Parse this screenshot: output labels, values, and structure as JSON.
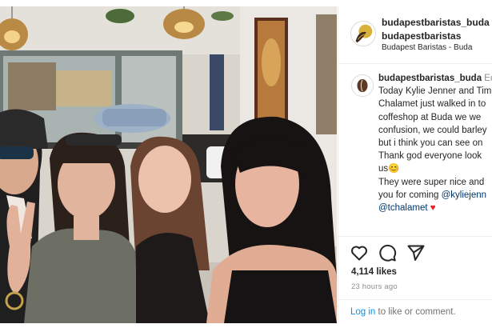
{
  "post": {
    "username": "budapestbaristas_buda",
    "username_suffix": "a",
    "account_name": "budapestbaristas",
    "location": "Budapest Baristas - Buda"
  },
  "caption": {
    "username": "budapestbaristas_buda",
    "time_hint": "Ed",
    "lines": [
      "Today Kylie Jenner and Tim",
      "Chalamet just walked in to",
      "coffeshop at Buda we we",
      "confusion, we could barley",
      "but i think you can see on",
      "Thank god everyone look",
      "us"
    ],
    "emoji": "😊",
    "line_after_1": "They were super nice and",
    "line_after_2_prefix": "you for coming ",
    "mention_1": "@kyliejenn",
    "mention_2": "@tchalamet",
    "heart": "♥"
  },
  "actions": {
    "like_icon": "heart-outline-icon",
    "comment_icon": "comment-bubble-icon",
    "share_icon": "paper-plane-icon"
  },
  "likes_text": "4,114 likes",
  "time_ago": "23 hours ago",
  "login": {
    "link_text": "Log in",
    "rest_text": " to like or comment."
  },
  "colors": {
    "link_blue": "#0095f6",
    "mention_blue": "#00376b",
    "heart_red": "#ed1c24",
    "secondary_text": "#8e8e8e"
  }
}
